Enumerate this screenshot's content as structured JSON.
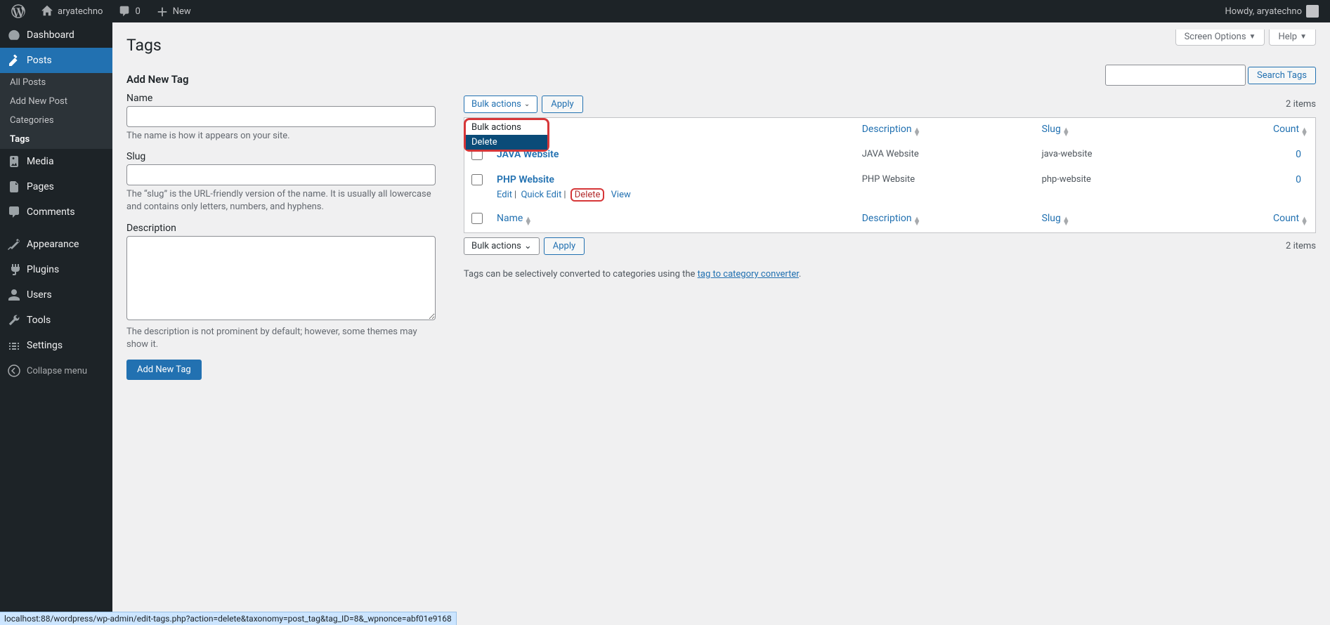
{
  "admin_bar": {
    "site_name": "aryatechno",
    "comments_count": "0",
    "new_label": "New",
    "howdy": "Howdy, aryatechno"
  },
  "sidebar": {
    "dashboard": "Dashboard",
    "posts": "Posts",
    "posts_sub": [
      "All Posts",
      "Add New Post",
      "Categories",
      "Tags"
    ],
    "media": "Media",
    "pages": "Pages",
    "comments": "Comments",
    "appearance": "Appearance",
    "plugins": "Plugins",
    "users": "Users",
    "tools": "Tools",
    "settings": "Settings",
    "collapse": "Collapse menu"
  },
  "screen_meta": {
    "screen_options": "Screen Options",
    "help": "Help"
  },
  "page": {
    "title": "Tags",
    "add_new_heading": "Add New Tag"
  },
  "form": {
    "name_label": "Name",
    "name_desc": "The name is how it appears on your site.",
    "slug_label": "Slug",
    "slug_desc": "The “slug” is the URL-friendly version of the name. It is usually all lowercase and contains only letters, numbers, and hyphens.",
    "desc_label": "Description",
    "desc_desc": "The description is not prominent by default; however, some themes may show it.",
    "submit": "Add New Tag"
  },
  "search": {
    "button": "Search Tags"
  },
  "bulk": {
    "label": "Bulk actions",
    "apply": "Apply",
    "options": [
      "Bulk actions",
      "Delete"
    ]
  },
  "count_label": "2 items",
  "table": {
    "cols": {
      "name": "Name",
      "desc": "Description",
      "slug": "Slug",
      "count": "Count"
    },
    "rows": [
      {
        "name": "JAVA Website",
        "desc": "JAVA Website",
        "slug": "java-website",
        "count": "0"
      },
      {
        "name": "PHP Website",
        "desc": "PHP Website",
        "slug": "php-website",
        "count": "0"
      }
    ],
    "actions": {
      "edit": "Edit",
      "quick": "Quick Edit",
      "delete": "Delete",
      "view": "View"
    }
  },
  "converter": {
    "pre": "Tags can be selectively converted to categories using the ",
    "link": "tag to category converter",
    "post": "."
  },
  "status_bar": "localhost:88/wordpress/wp-admin/edit-tags.php?action=delete&taxonomy=post_tag&tag_ID=8&_wpnonce=abf01e9168"
}
